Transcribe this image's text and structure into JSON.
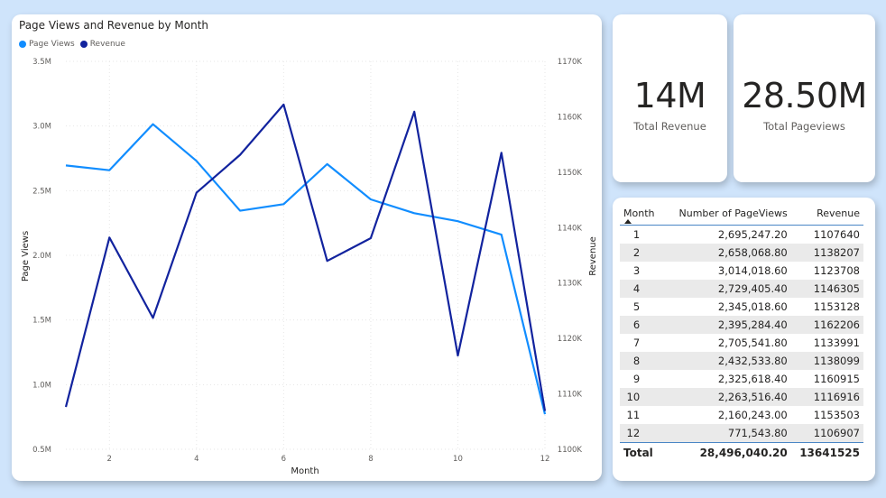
{
  "chart_data": {
    "type": "line",
    "title": "Page Views and Revenue by Month",
    "xlabel": "Month",
    "ylabel": "Page Views",
    "y2label": "Revenue",
    "x": [
      1,
      2,
      3,
      4,
      5,
      6,
      7,
      8,
      9,
      10,
      11,
      12
    ],
    "xlim": [
      1,
      12
    ],
    "xticks": [
      2,
      4,
      6,
      8,
      10,
      12
    ],
    "ylim": [
      500000,
      3500000
    ],
    "yticks": [
      500000,
      1000000,
      1500000,
      2000000,
      2500000,
      3000000,
      3500000
    ],
    "ytick_labels": [
      "0.5M",
      "1.0M",
      "1.5M",
      "2.0M",
      "2.5M",
      "3.0M",
      "3.5M"
    ],
    "y2lim": [
      1100000,
      1170000
    ],
    "y2ticks": [
      1100000,
      1110000,
      1120000,
      1130000,
      1140000,
      1150000,
      1160000,
      1170000
    ],
    "y2tick_labels": [
      "1100K",
      "1110K",
      "1120K",
      "1130K",
      "1140K",
      "1150K",
      "1160K",
      "1170K"
    ],
    "grid": true,
    "legend_position": "top-left",
    "series": [
      {
        "name": "Page Views",
        "axis": "left",
        "color": "#118dff",
        "values": [
          2695247.2,
          2658068.8,
          3014018.6,
          2729405.4,
          2345018.6,
          2395284.4,
          2705541.8,
          2432533.8,
          2325618.4,
          2263516.4,
          2160243.0,
          771543.8
        ]
      },
      {
        "name": "Revenue",
        "axis": "right",
        "color": "#12239e",
        "values": [
          1107640,
          1138207,
          1123708,
          1146305,
          1153128,
          1162206,
          1133991,
          1138099,
          1160915,
          1116916,
          1153503,
          1106907
        ]
      }
    ]
  },
  "kpis": {
    "revenue": {
      "value": "14M",
      "label": "Total Revenue"
    },
    "pageviews": {
      "value": "28.50M",
      "label": "Total Pageviews"
    }
  },
  "table": {
    "headers": {
      "month": "Month",
      "pageviews": "Number of PageViews",
      "revenue": "Revenue"
    },
    "rows": [
      {
        "month": "1",
        "pageviews": "2,695,247.20",
        "revenue": "1107640"
      },
      {
        "month": "2",
        "pageviews": "2,658,068.80",
        "revenue": "1138207"
      },
      {
        "month": "3",
        "pageviews": "3,014,018.60",
        "revenue": "1123708"
      },
      {
        "month": "4",
        "pageviews": "2,729,405.40",
        "revenue": "1146305"
      },
      {
        "month": "5",
        "pageviews": "2,345,018.60",
        "revenue": "1153128"
      },
      {
        "month": "6",
        "pageviews": "2,395,284.40",
        "revenue": "1162206"
      },
      {
        "month": "7",
        "pageviews": "2,705,541.80",
        "revenue": "1133991"
      },
      {
        "month": "8",
        "pageviews": "2,432,533.80",
        "revenue": "1138099"
      },
      {
        "month": "9",
        "pageviews": "2,325,618.40",
        "revenue": "1160915"
      },
      {
        "month": "10",
        "pageviews": "2,263,516.40",
        "revenue": "1116916"
      },
      {
        "month": "11",
        "pageviews": "2,160,243.00",
        "revenue": "1153503"
      },
      {
        "month": "12",
        "pageviews": "771,543.80",
        "revenue": "1106907"
      }
    ],
    "total": {
      "label": "Total",
      "pageviews": "28,496,040.20",
      "revenue": "13641525"
    }
  }
}
